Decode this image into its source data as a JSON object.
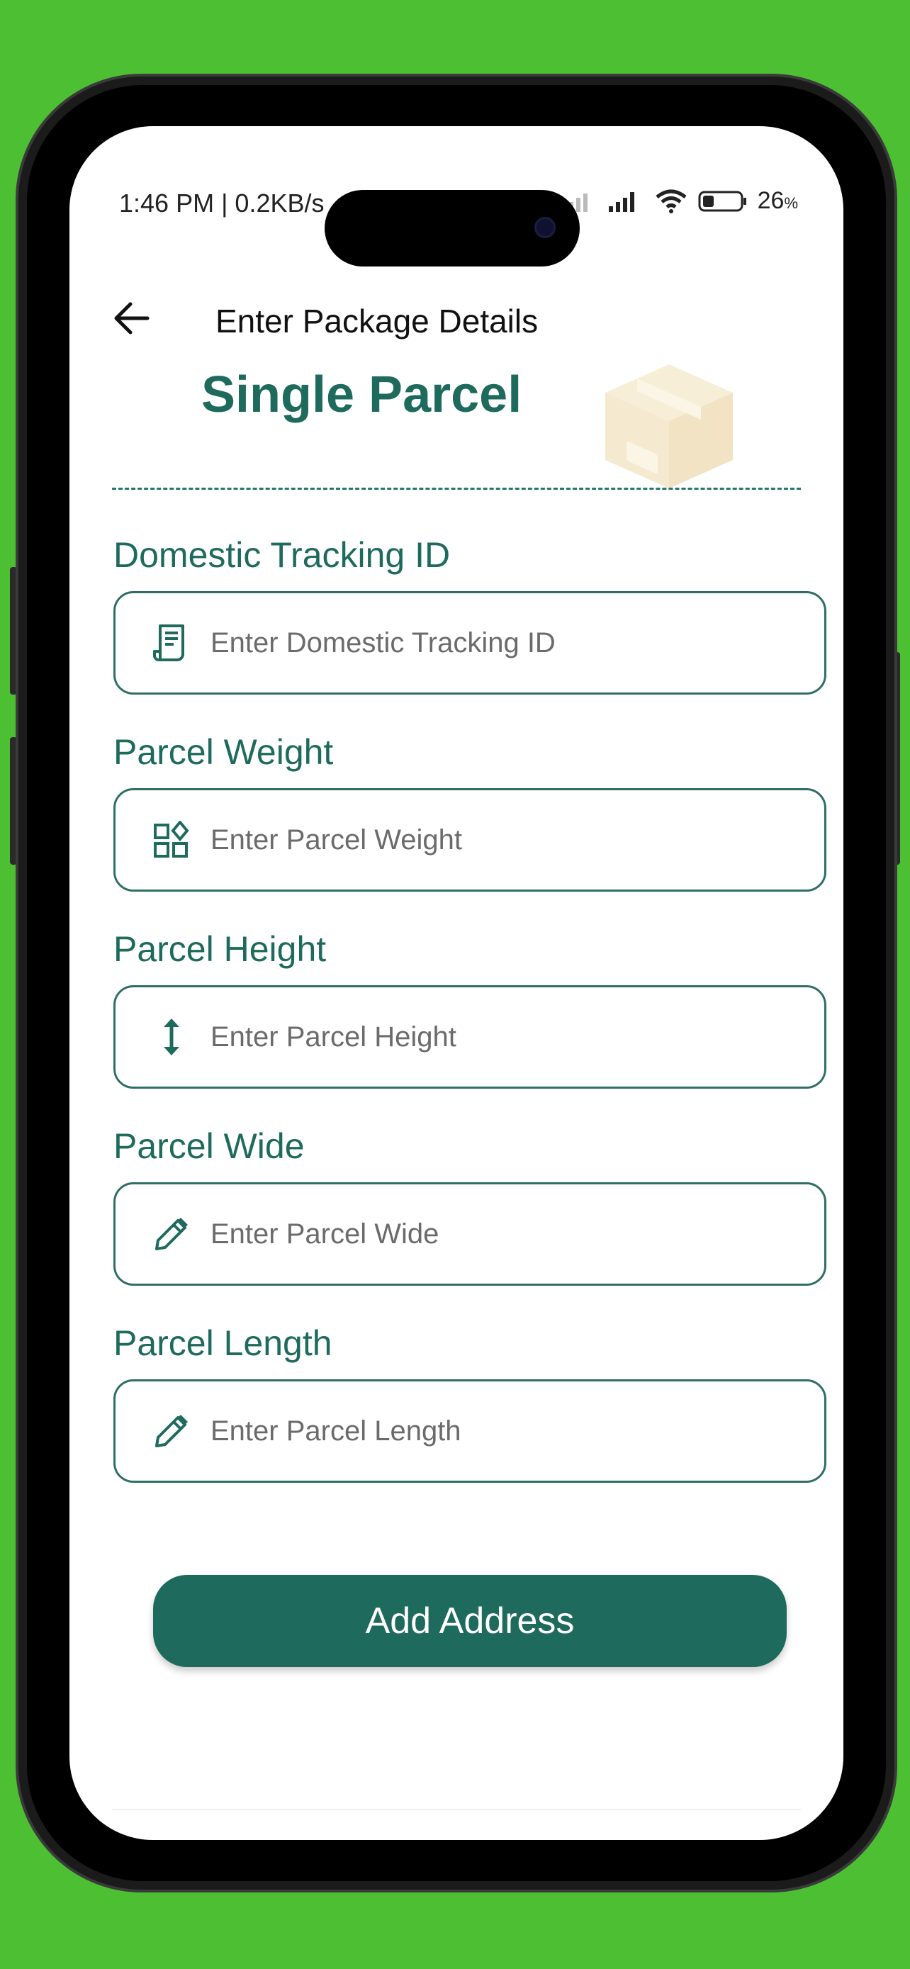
{
  "status_bar": {
    "time_text": "1:46 PM | 0.2KB/s",
    "battery_percent": "26",
    "battery_unit": "%"
  },
  "header": {
    "title": "Enter Package Details"
  },
  "hero": {
    "title": "Single Parcel"
  },
  "fields": [
    {
      "label": "Domestic Tracking ID",
      "placeholder": "Enter Domestic Tracking ID",
      "value": "",
      "icon": "receipt-icon"
    },
    {
      "label": "Parcel Weight",
      "placeholder": "Enter Parcel Weight",
      "value": "",
      "icon": "category-icon"
    },
    {
      "label": "Parcel Height",
      "placeholder": "Enter Parcel Height",
      "value": "",
      "icon": "vertical-arrows-icon"
    },
    {
      "label": "Parcel Wide",
      "placeholder": "Enter Parcel Wide",
      "value": "",
      "icon": "pencil-icon"
    },
    {
      "label": "Parcel Length",
      "placeholder": "Enter Parcel Length",
      "value": "",
      "icon": "pencil-icon"
    }
  ],
  "actions": {
    "add_address_label": "Add Address"
  },
  "colors": {
    "background": "#4cbf32",
    "primary": "#1e6b5d",
    "box_icon": "#f5ead0"
  }
}
